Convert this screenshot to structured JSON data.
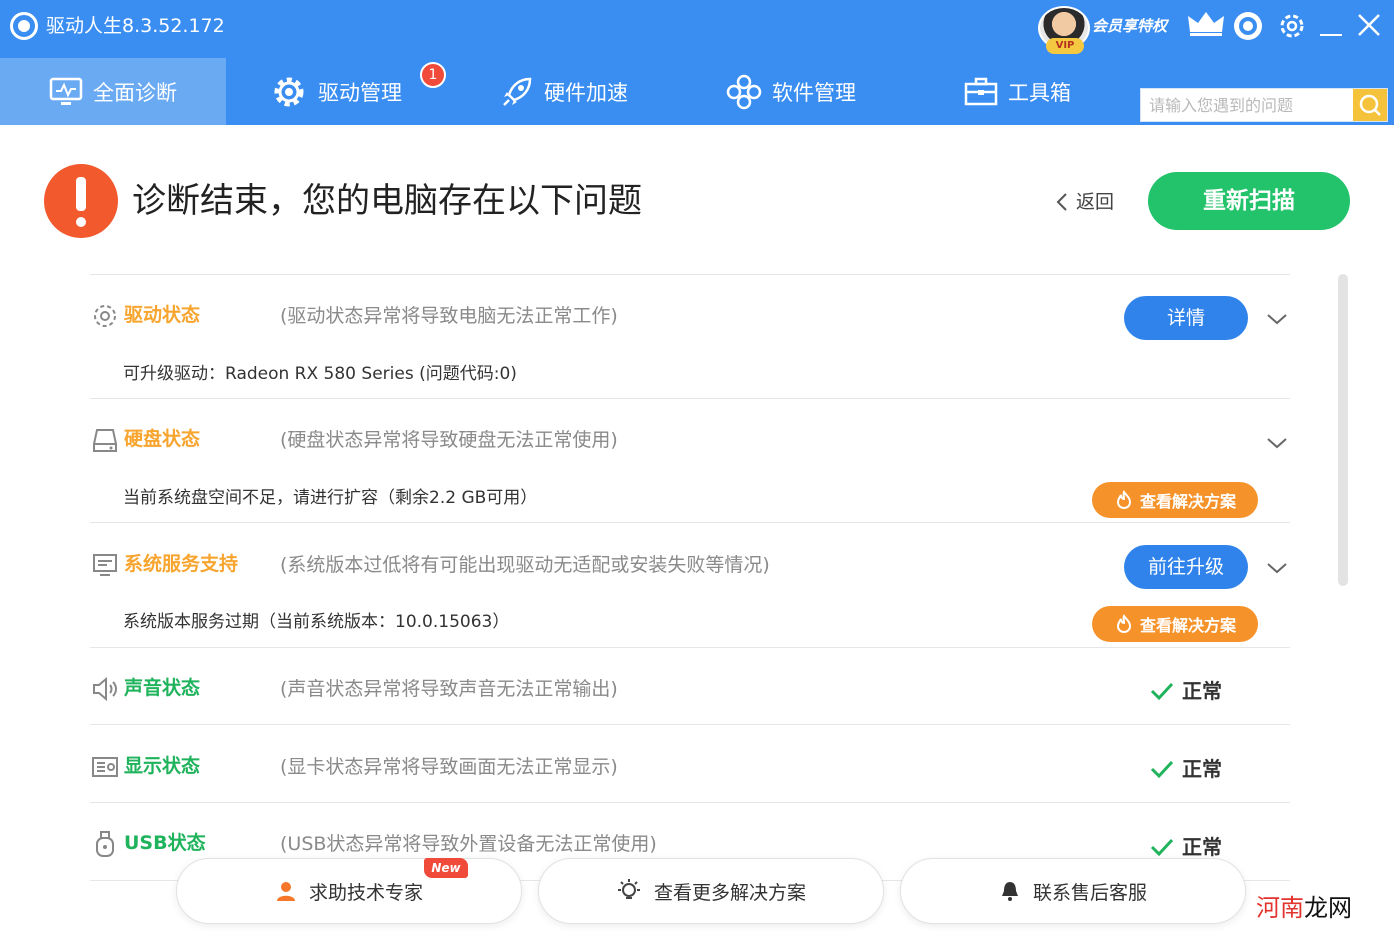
{
  "app": {
    "title": "驱动人生8.3.52.172",
    "vip_badge": "VIP",
    "vip_label": "会员享特权"
  },
  "nav": {
    "tabs": [
      {
        "label": "全面诊断",
        "active": true
      },
      {
        "label": "驱动管理",
        "badge": "1"
      },
      {
        "label": "硬件加速"
      },
      {
        "label": "软件管理"
      },
      {
        "label": "工具箱"
      }
    ],
    "search_placeholder": "请输入您遇到的问题"
  },
  "header": {
    "title": "诊断结束，您的电脑存在以下问题",
    "back_label": "返回",
    "rescan_label": "重新扫描"
  },
  "rows": [
    {
      "icon": "gear-icon",
      "name": "驱动状态",
      "status": "warn",
      "desc": "(驱动状态异常将导致电脑无法正常工作)",
      "action": "详情",
      "detail": "可升级驱动：Radeon RX 580 Series (问题代码:0)"
    },
    {
      "icon": "disk-icon",
      "name": "硬盘状态",
      "status": "warn",
      "desc": "(硬盘状态异常将导致硬盘无法正常使用)",
      "detail": "当前系统盘空间不足，请进行扩容（剩余2.2 GB可用）",
      "solution": "查看解决方案"
    },
    {
      "icon": "system-icon",
      "name": "系统服务支持",
      "status": "warn",
      "desc": "(系统版本过低将有可能出现驱动无适配或安装失败等情况)",
      "action": "前往升级",
      "detail": "系统版本服务过期（当前系统版本：10.0.15063）",
      "solution": "查看解决方案"
    },
    {
      "icon": "speaker-icon",
      "name": "声音状态",
      "status": "ok",
      "desc": "(声音状态异常将导致声音无法正常输出)",
      "result": "正常"
    },
    {
      "icon": "display-icon",
      "name": "显示状态",
      "status": "ok",
      "desc": "(显卡状态异常将导致画面无法正常显示)",
      "result": "正常"
    },
    {
      "icon": "usb-icon",
      "name": "USB状态",
      "status": "ok",
      "desc": "(USB状态异常将导致外置设备无法正常使用)",
      "result": "正常"
    }
  ],
  "bottom": {
    "expert_label": "求助技术专家",
    "new_badge": "New",
    "more_label": "查看更多解决方案",
    "service_label": "联系售后客服"
  },
  "watermark": {
    "part1": "河南",
    "part2": "龙网"
  },
  "colors": {
    "brand_blue": "#3a8ef2",
    "warn_orange": "#f7a52f",
    "ok_green": "#1fb35c",
    "rescan_green": "#22c36a",
    "alert_red": "#f2592c"
  }
}
